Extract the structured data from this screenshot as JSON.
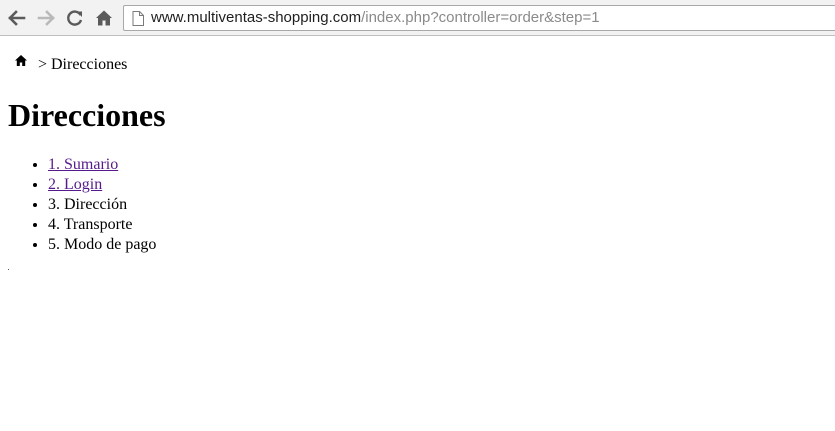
{
  "browser": {
    "url_host": "www.multiventas-shopping.com",
    "url_path": "/index.php?controller=order&step=1"
  },
  "breadcrumb": {
    "separator": ">",
    "current": "Direcciones"
  },
  "page": {
    "title": "Direcciones"
  },
  "steps": [
    {
      "label": "1. Sumario"
    },
    {
      "label": "2. Login"
    },
    {
      "label": "3. Dirección"
    },
    {
      "label": "4. Transporte"
    },
    {
      "label": "5. Modo de pago"
    }
  ]
}
